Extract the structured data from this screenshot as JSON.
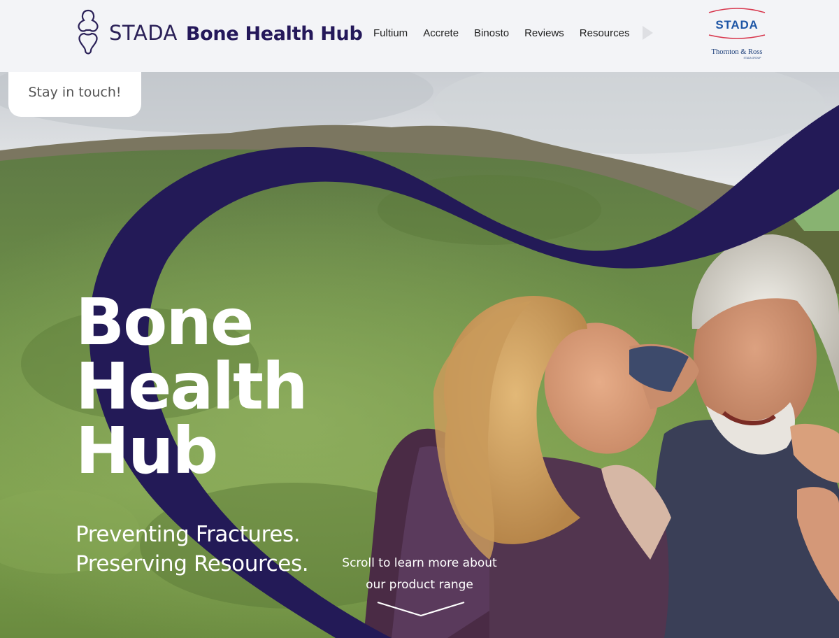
{
  "header": {
    "brand_stada": "STADA",
    "brand_name": "Bone Health Hub",
    "nav": [
      {
        "label": "Fultium"
      },
      {
        "label": "Accrete"
      },
      {
        "label": "Binosto"
      },
      {
        "label": "Reviews"
      },
      {
        "label": "Resources"
      }
    ],
    "nav_next_icon": "play-triangle-icon",
    "partner_logo": {
      "name": "STADA",
      "subtitle": "Thornton & Ross",
      "small": "STADA GROUP"
    }
  },
  "stay_in_touch": "Stay in touch!",
  "hero": {
    "title_lines": [
      "Bone",
      "Health",
      "Hub"
    ],
    "tagline_lines": [
      "Preventing Fractures.",
      "Preserving Resources."
    ],
    "scroll_lines": [
      "Scroll to learn more about",
      "our product range"
    ]
  },
  "colors": {
    "brand_purple": "#231a57",
    "header_bg": "#f3f4f7",
    "logo_red": "#d8384e",
    "logo_blue": "#1d55a5"
  }
}
